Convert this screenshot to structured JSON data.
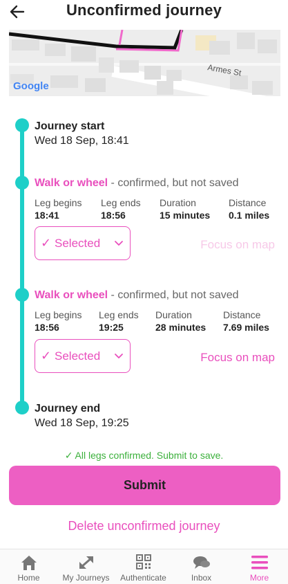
{
  "header": {
    "title": "Unconfirmed journey"
  },
  "map": {
    "street_label": "Armes St",
    "provider": "Google"
  },
  "journey_start": {
    "label": "Journey start",
    "time": "Wed 18 Sep, 18:41"
  },
  "legs": [
    {
      "mode": "Walk or wheel",
      "status": " - confirmed, but not saved",
      "begins_label": "Leg begins",
      "begins": "18:41",
      "ends_label": "Leg ends",
      "ends": "18:56",
      "duration_label": "Duration",
      "duration": "15 minutes",
      "distance_label": "Distance",
      "distance": "0.1 miles",
      "selected_label": "Selected",
      "focus_label": "Focus on map"
    },
    {
      "mode": "Walk or wheel",
      "status": " - confirmed, but not saved",
      "begins_label": "Leg begins",
      "begins": "18:56",
      "ends_label": "Leg ends",
      "ends": "19:25",
      "duration_label": "Duration",
      "duration": "28 minutes",
      "distance_label": "Distance",
      "distance": "7.69 miles",
      "selected_label": "Selected",
      "focus_label": "Focus on map"
    }
  ],
  "journey_end": {
    "label": "Journey end",
    "time": "Wed 18 Sep, 19:25"
  },
  "confirmation": "✓ All legs confirmed. Submit to save.",
  "submit_label": "Submit",
  "delete_label": "Delete unconfirmed journey",
  "tabs": [
    {
      "label": "Home",
      "icon": "home-icon"
    },
    {
      "label": "My Journeys",
      "icon": "expand-arrows-icon"
    },
    {
      "label": "Authenticate",
      "icon": "qr-code-icon"
    },
    {
      "label": "Inbox",
      "icon": "chat-bubbles-icon"
    },
    {
      "label": "More",
      "icon": "menu-icon",
      "active": true
    }
  ],
  "colors": {
    "accent": "#e94fbd",
    "timeline": "#1ecfc8",
    "success": "#3bb03b",
    "submit_bg": "#ed5fc3"
  }
}
